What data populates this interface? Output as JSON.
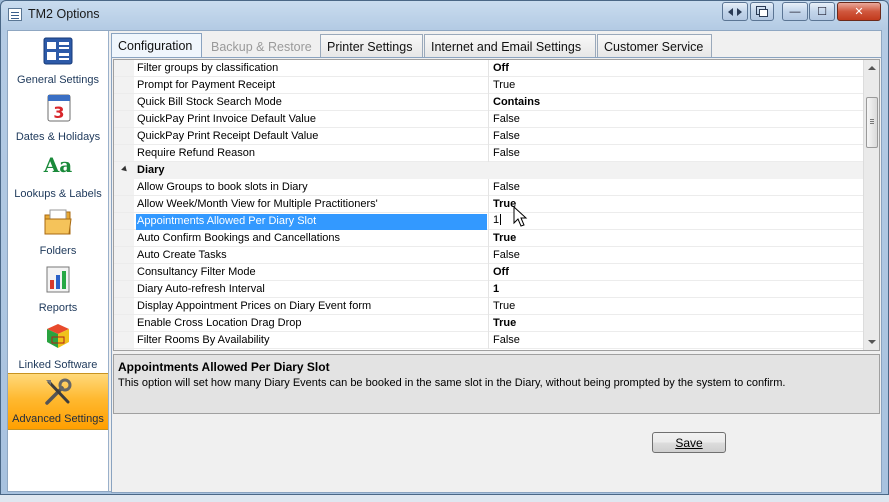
{
  "window": {
    "title": "TM2 Options",
    "buttons": {
      "minimize": "—",
      "maximize": "☐",
      "close": "✕"
    }
  },
  "nav": {
    "items": [
      {
        "label": "General Settings",
        "icon": "general-settings-icon"
      },
      {
        "label": "Dates & Holidays",
        "icon": "calendar-icon",
        "calendar_day": "3"
      },
      {
        "label": "Lookups & Labels",
        "icon": "lookups-icon",
        "glyph": "Aa"
      },
      {
        "label": "Folders",
        "icon": "folder-icon"
      },
      {
        "label": "Reports",
        "icon": "reports-icon"
      },
      {
        "label": "Linked Software",
        "icon": "linked-software-icon"
      },
      {
        "label": "Advanced Settings",
        "icon": "tools-icon",
        "active": true
      }
    ]
  },
  "tabs": [
    {
      "label": "Configuration",
      "active": true
    },
    {
      "label": "Backup & Restore",
      "disabled": true
    },
    {
      "label": "Printer Settings"
    },
    {
      "label": "Internet and Email Settings"
    },
    {
      "label": "Customer Service"
    }
  ],
  "grid": {
    "rows_top": [
      {
        "name": "Filter groups by classification",
        "value": "Off",
        "bold": true
      },
      {
        "name": "Prompt for Payment Receipt",
        "value": "True",
        "bold": false
      },
      {
        "name": "Quick Bill Stock Search Mode",
        "value": "Contains",
        "bold": true
      },
      {
        "name": "QuickPay Print Invoice Default Value",
        "value": "False",
        "bold": false
      },
      {
        "name": "QuickPay Print Receipt Default Value",
        "value": "False",
        "bold": false
      },
      {
        "name": "Require Refund Reason",
        "value": "False",
        "bold": false
      }
    ],
    "category": "Diary",
    "rows_diary": [
      {
        "name": "Allow Groups to book slots in Diary",
        "value": "False",
        "bold": false
      },
      {
        "name": "Allow Week/Month View for Multiple Practitioners'",
        "value": "True",
        "bold": true
      },
      {
        "name": "Appointments Allowed Per Diary Slot",
        "value": "1",
        "bold": false,
        "selected": true
      },
      {
        "name": "Auto Confirm Bookings and Cancellations",
        "value": "True",
        "bold": true
      },
      {
        "name": "Auto Create Tasks",
        "value": "False",
        "bold": false
      },
      {
        "name": "Consultancy Filter Mode",
        "value": "Off",
        "bold": true
      },
      {
        "name": "Diary Auto-refresh Interval",
        "value": "1",
        "bold": true
      },
      {
        "name": "Display Appointment Prices on Diary Event form",
        "value": "True",
        "bold": false
      },
      {
        "name": "Enable Cross Location Drag Drop",
        "value": "True",
        "bold": true
      },
      {
        "name": "Filter Rooms By Availability",
        "value": "False",
        "bold": false
      }
    ]
  },
  "description": {
    "title": "Appointments Allowed Per Diary Slot",
    "text": "This option will set how many Diary Events can be booked in the same slot in the Diary, without being prompted by the system to confirm."
  },
  "footer": {
    "save_label": "Save"
  },
  "colors": {
    "selection": "#3399ff",
    "active_nav": "#ffb930",
    "accent": "#1e395b"
  }
}
